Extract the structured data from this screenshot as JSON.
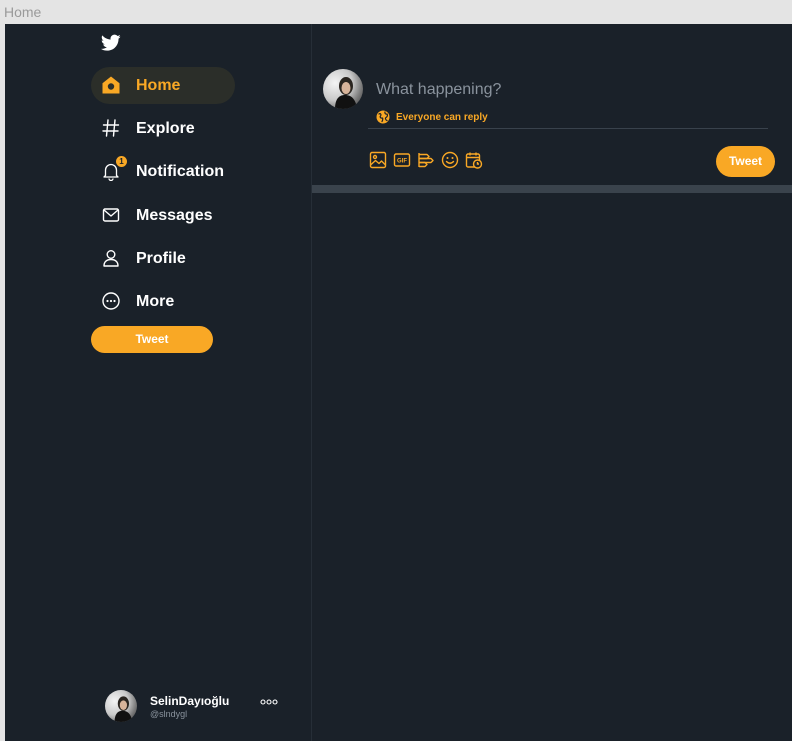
{
  "frame": {
    "label": "Home"
  },
  "brand": {
    "accent": "#f9a825",
    "background": "#1a2129",
    "logo_icon": "twitter-bird-icon"
  },
  "sidebar": {
    "items": [
      {
        "label": "Home",
        "icon": "home-icon",
        "active": true
      },
      {
        "label": "Explore",
        "icon": "hashtag-icon"
      },
      {
        "label": "Notification",
        "icon": "bell-icon",
        "badge": "1"
      },
      {
        "label": "Messages",
        "icon": "envelope-icon"
      },
      {
        "label": "Profile",
        "icon": "user-icon"
      },
      {
        "label": "More",
        "icon": "more-circle-icon"
      }
    ],
    "tweet_button": "Tweet"
  },
  "user": {
    "name": "SelinDayıoğlu",
    "handle": "@slndygl"
  },
  "compose": {
    "placeholder": "What happening?",
    "reply_scope": "Everyone can reply",
    "tools": [
      "image-icon",
      "gif-icon",
      "poll-icon",
      "emoji-icon",
      "schedule-icon"
    ],
    "tweet_button": "Tweet"
  }
}
